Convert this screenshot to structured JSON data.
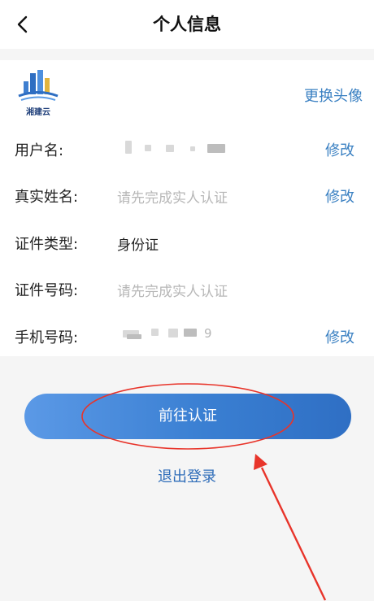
{
  "header": {
    "title": "个人信息",
    "back_icon": "chevron-left-icon"
  },
  "avatar": {
    "caption": "湘建云",
    "change_label": "更换头像"
  },
  "rows": [
    {
      "label": "用户名:",
      "value": "",
      "edit": "修改"
    },
    {
      "label": "真实姓名:",
      "value": "请先完成实人认证",
      "edit": "修改"
    },
    {
      "label": "证件类型:",
      "value": "身份证",
      "edit": ""
    },
    {
      "label": "证件号码:",
      "value": "请先完成实人认证",
      "edit": ""
    },
    {
      "label": "手机号码:",
      "value": "9",
      "edit": "修改"
    }
  ],
  "actions": {
    "primary": "前往认证",
    "logout": "退出登录"
  },
  "colors": {
    "accent": "#3a80c2",
    "button_start": "#5b99e6",
    "button_end": "#2f6fc4",
    "annotation": "#e8342a"
  }
}
